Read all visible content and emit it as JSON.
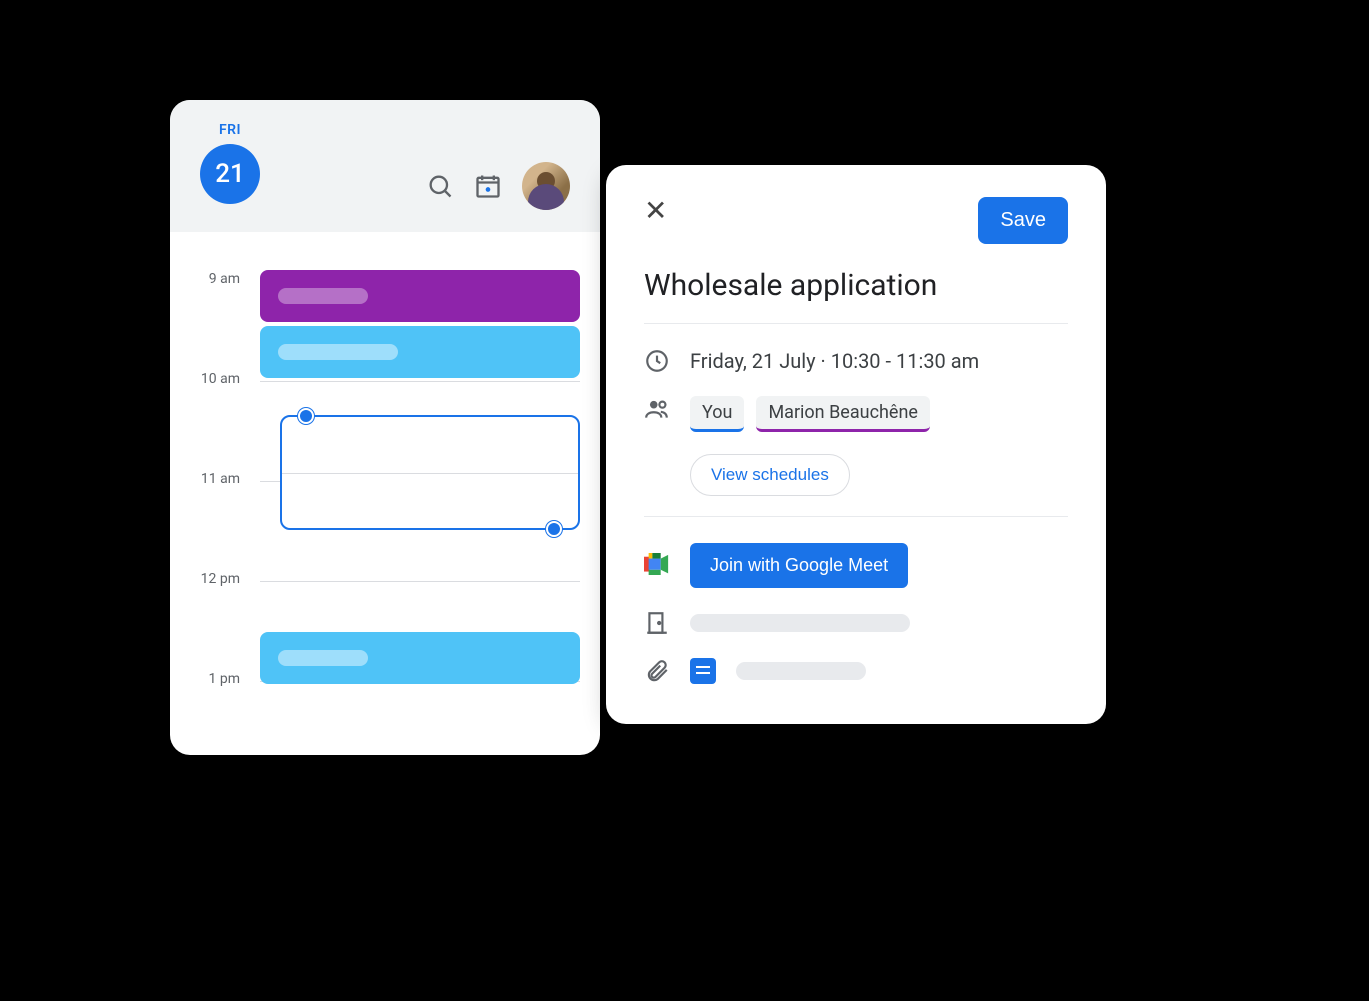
{
  "calendar": {
    "day_name": "FRI",
    "day_number": "21",
    "hours": [
      "9 am",
      "10 am",
      "11 am",
      "12 pm",
      "1 pm"
    ]
  },
  "event": {
    "title": "Wholesale application",
    "when": "Friday, 21 July  ·  10:30 - 11:30 am",
    "attendees": {
      "you": "You",
      "guest": "Marion Beauchêne"
    },
    "view_schedules": "View schedules",
    "join_label": "Join with Google Meet",
    "save_label": "Save"
  }
}
